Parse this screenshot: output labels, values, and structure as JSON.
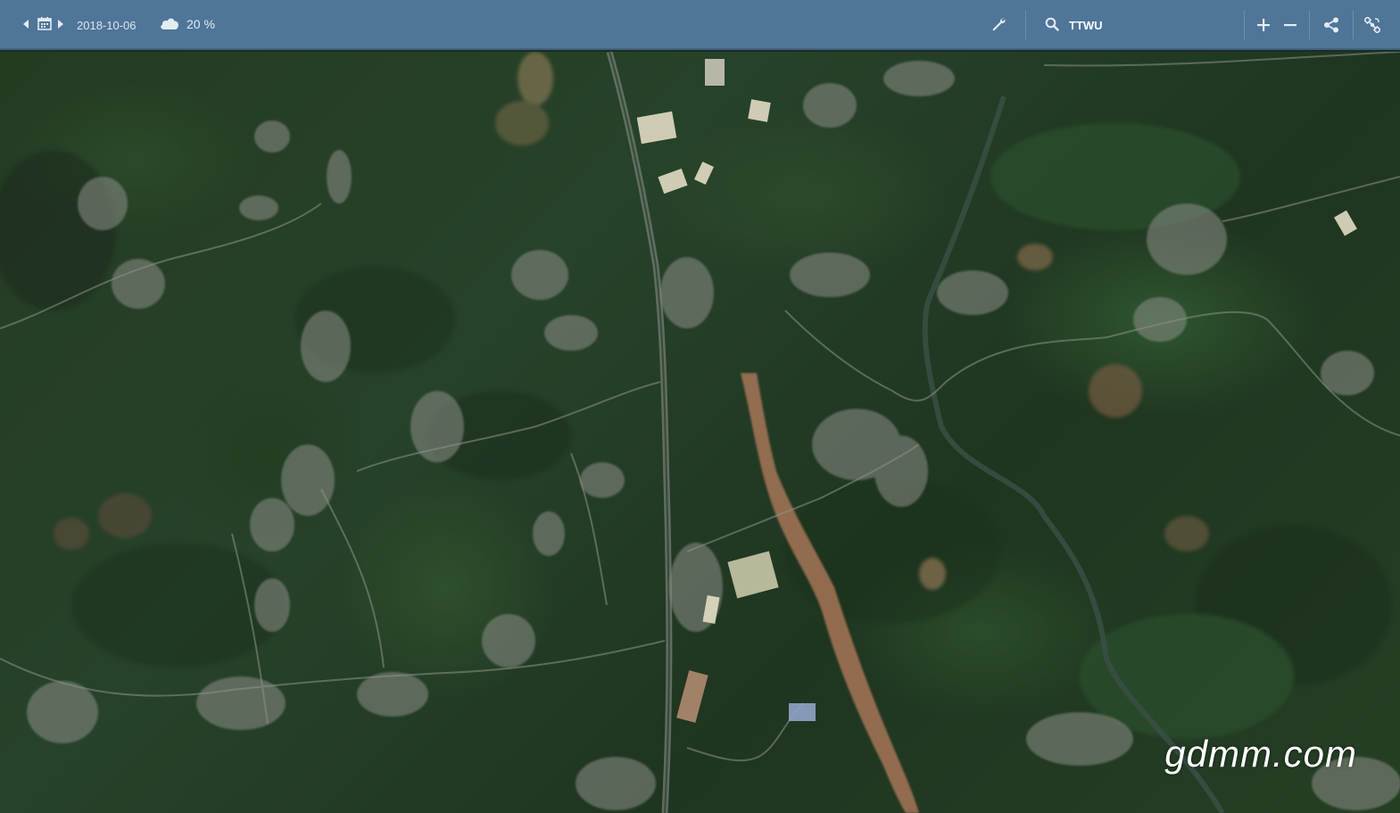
{
  "toolbar": {
    "date": "2018-10-06",
    "cloud_coverage": "20 %",
    "search_value": "TTWU"
  },
  "icons": {
    "date_prev": "caret-left-icon",
    "calendar": "calendar-icon",
    "date_next": "caret-right-icon",
    "cloud": "cloud-icon",
    "wrench": "wrench-icon",
    "search": "search-icon",
    "zoom_in": "plus-icon",
    "zoom_out": "minus-icon",
    "share": "share-icon",
    "tools": "satellite-icon"
  },
  "map": {
    "watermark": "gdmm.com"
  },
  "colors": {
    "toolbar_bg": "#4f7599",
    "vegetation": "#27422a",
    "bare_soil": "#c98a66"
  }
}
